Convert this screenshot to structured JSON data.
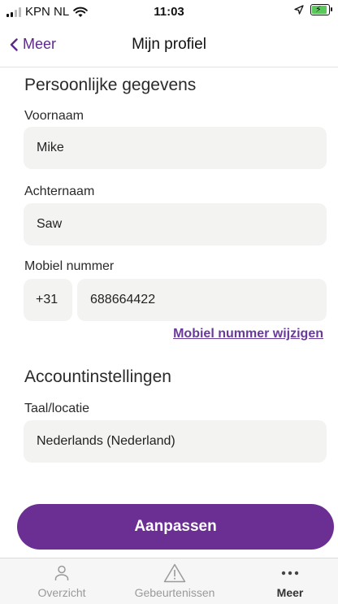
{
  "status_bar": {
    "carrier": "KPN NL",
    "time": "11:03"
  },
  "nav": {
    "back_label": "Meer",
    "title": "Mijn profiel"
  },
  "personal": {
    "section_title": "Persoonlijke gegevens",
    "first_name_label": "Voornaam",
    "first_name_value": "Mike",
    "last_name_label": "Achternaam",
    "last_name_value": "Saw",
    "mobile_label": "Mobiel nummer",
    "country_code": "+31",
    "mobile_value": "688664422",
    "change_mobile_link": "Mobiel nummer wijzigen"
  },
  "account": {
    "section_title": "Accountinstellingen",
    "language_label": "Taal/locatie",
    "language_value": "Nederlands (Nederland)"
  },
  "primary_button": "Aanpassen",
  "tabs": [
    {
      "label": "Overzicht",
      "icon": "person-icon",
      "active": false
    },
    {
      "label": "Gebeurtenissen",
      "icon": "warning-triangle-icon",
      "active": false
    },
    {
      "label": "Meer",
      "icon": "more-dots-icon",
      "active": true
    }
  ],
  "colors": {
    "accent": "#6b2f94",
    "link": "#6a3a9a",
    "field_bg": "#f3f4f1"
  }
}
